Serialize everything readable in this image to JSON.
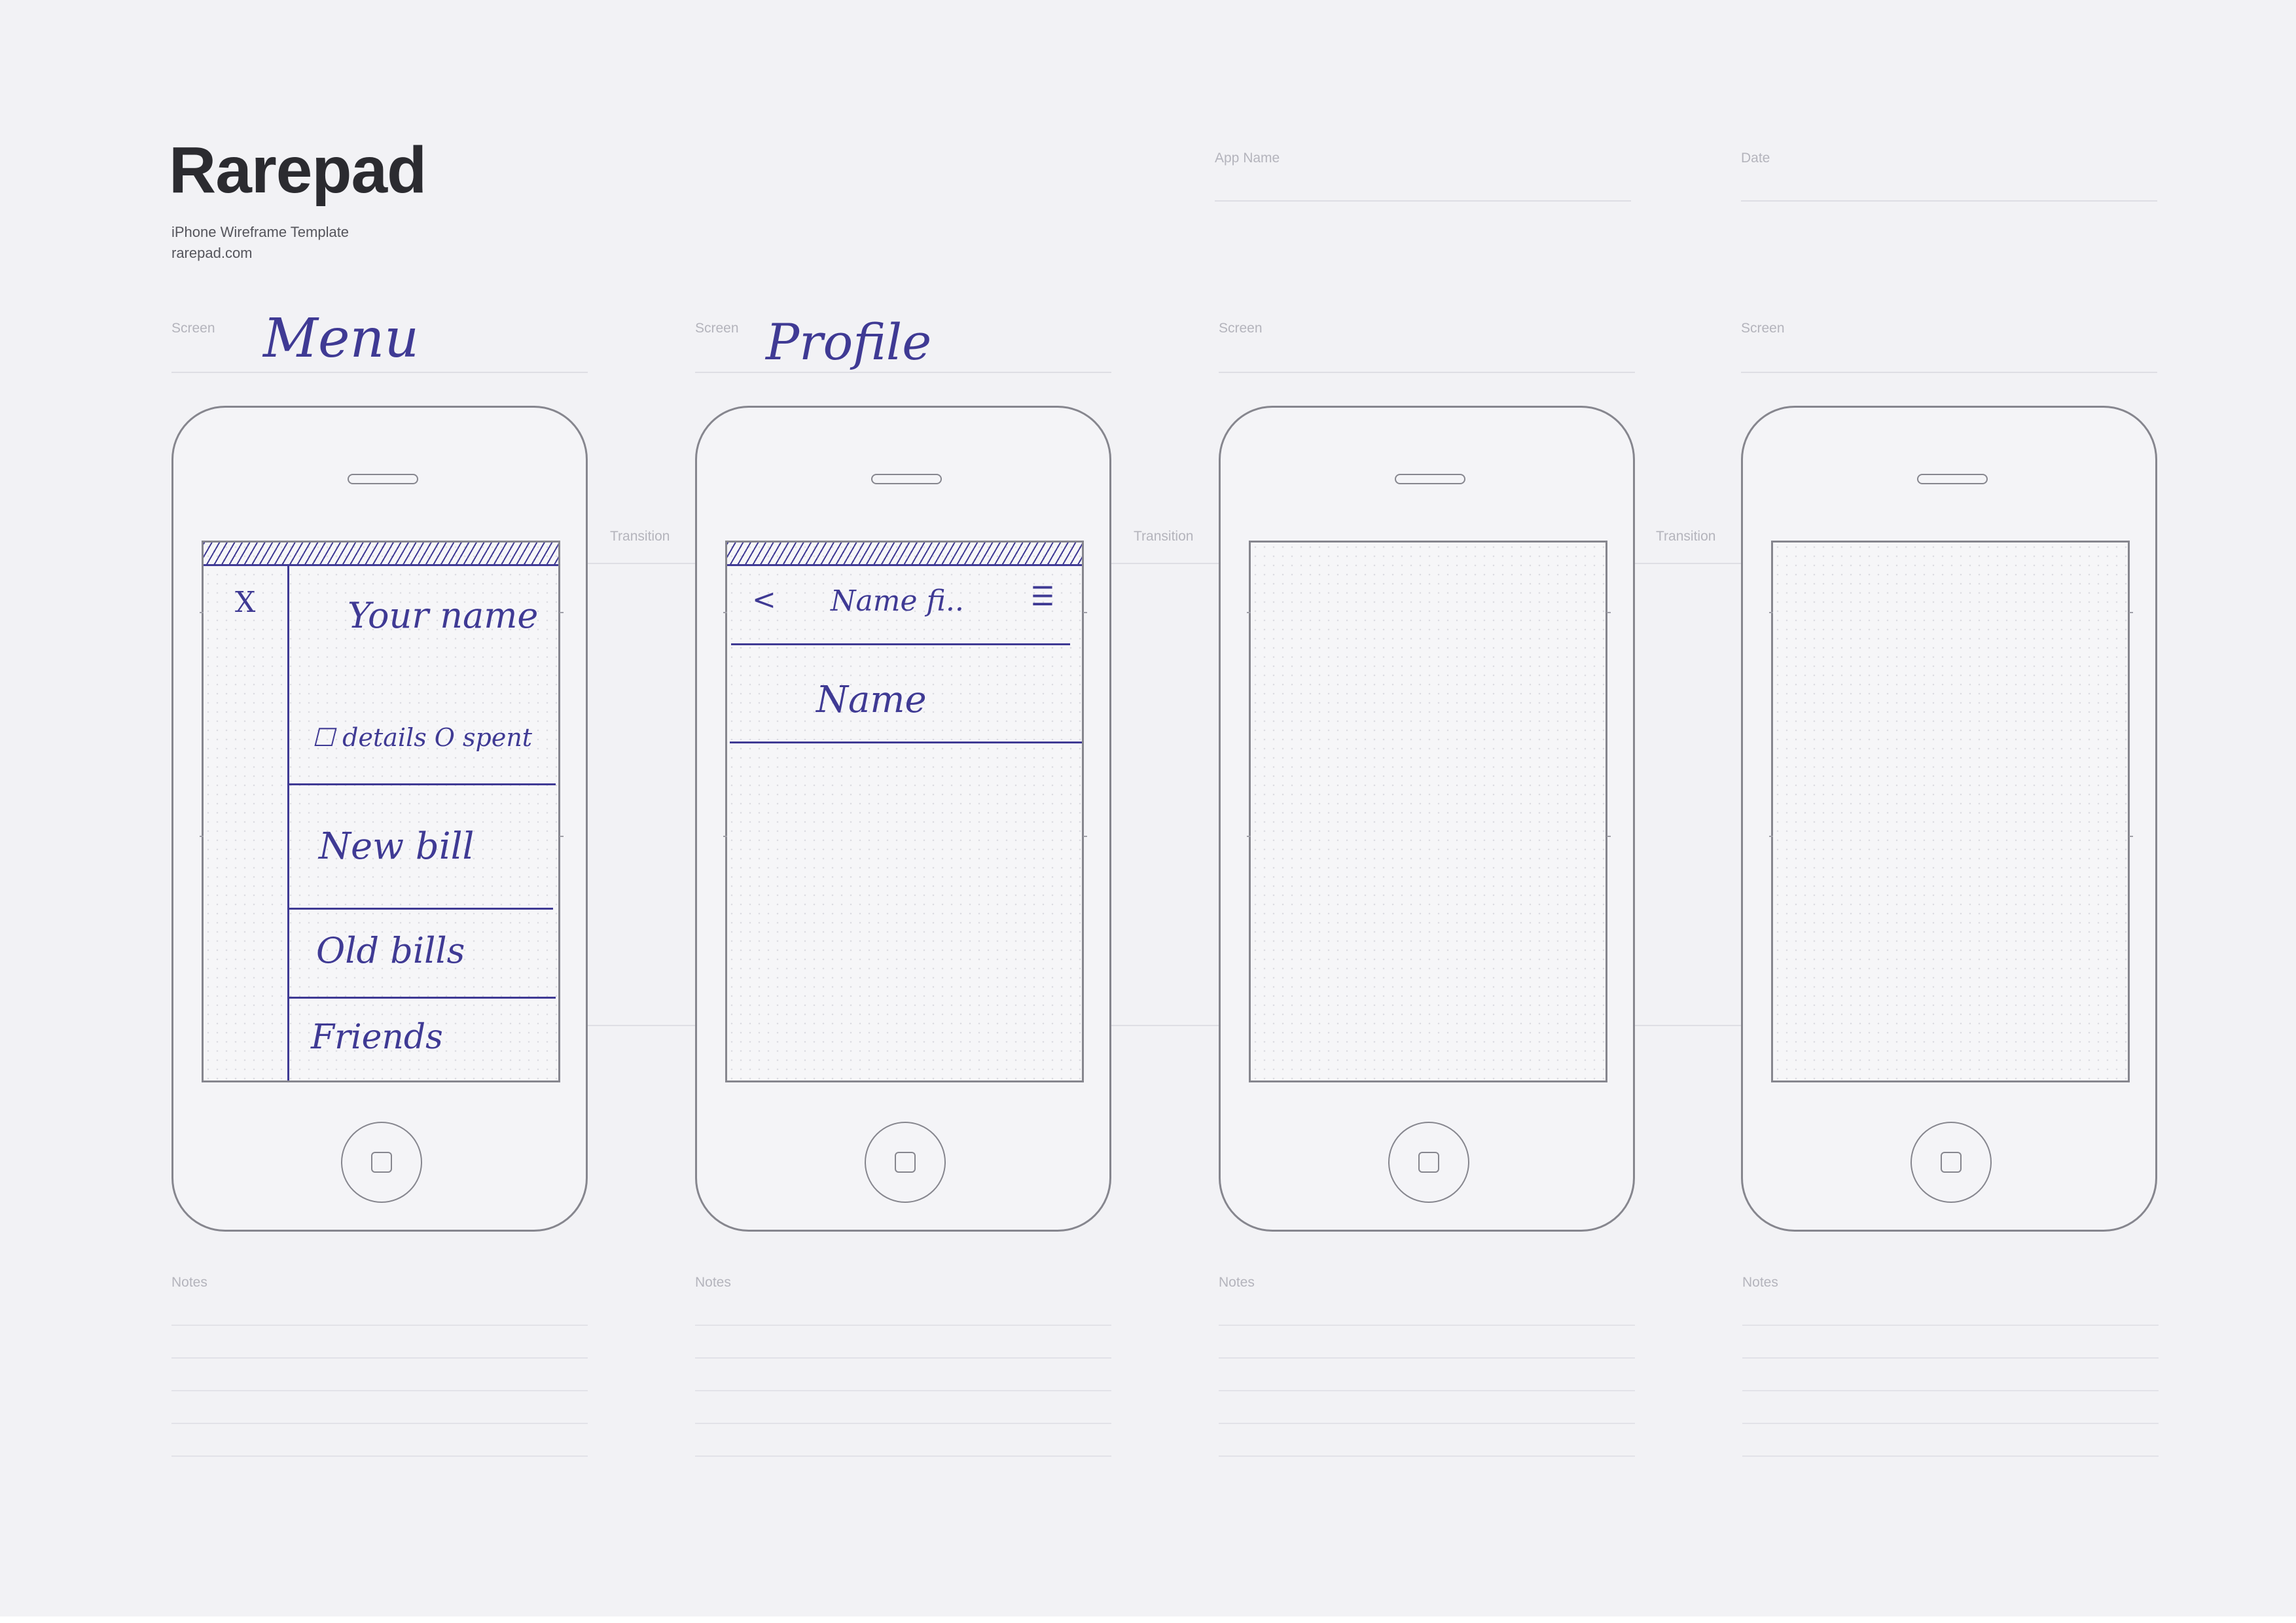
{
  "brand": {
    "title": "Rarepad",
    "subtitle": "iPhone Wireframe Template",
    "url": "rarepad.com"
  },
  "header_fields": {
    "app_name_label": "App Name",
    "date_label": "Date"
  },
  "screens": [
    {
      "label": "Screen",
      "name": "Menu",
      "close_glyph": "X",
      "items": [
        "Your name",
        "☐ details  O spent",
        "New bill",
        "Old bills",
        "Friends"
      ]
    },
    {
      "label": "Screen",
      "name": "Profile",
      "back_glyph": "<",
      "title": "Name fi..",
      "menu_glyph": "☰",
      "field": "Name"
    },
    {
      "label": "Screen",
      "name": ""
    },
    {
      "label": "Screen",
      "name": ""
    }
  ],
  "transition_label": "Transition",
  "notes_label": "Notes",
  "colors": {
    "ink": "#3f3a94",
    "outline": "#86868e",
    "paper": "#f2f2f5"
  }
}
